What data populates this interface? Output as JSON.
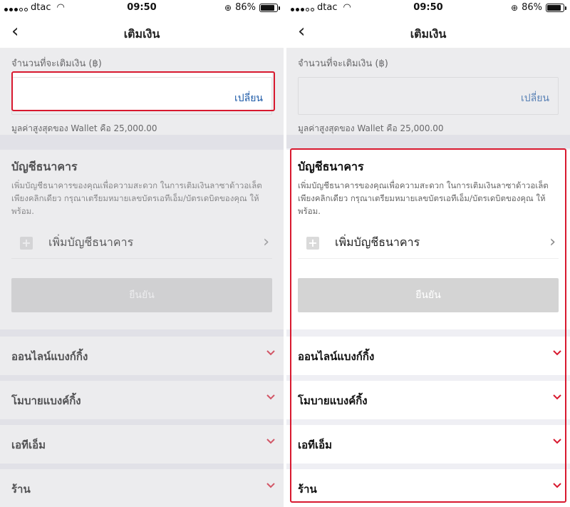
{
  "status_bar": {
    "carrier": "dtac",
    "time": "09:50",
    "battery": "86%"
  },
  "nav": {
    "title": "เติมเงิน"
  },
  "amount": {
    "label": "จำนวนที่จะเติมเงิน (฿)",
    "change_label": "เปลี่ยน",
    "max_note": "มูลค่าสูงสุดของ Wallet คือ 25,000.00"
  },
  "bank": {
    "title": "บัญชีธนาคาร",
    "description": "เพิ่มบัญชีธนาคารของคุณเพื่อความสะดวก ในการเติมเงินลาซาด้าวอเล็ต เพียงคลิกเดียว กรุณาเตรียมหมายเลขบัตรเอทีเอ็ม/บัตรเดบิตของคุณ ให้พร้อม.",
    "add_label": "เพิ่มบัญชีธนาคาร",
    "confirm_label": "ยืนยัน"
  },
  "methods": [
    {
      "label": "ออนไลน์แบงก์กิ้ง"
    },
    {
      "label": "โมบายแบงค์กิ้ง"
    },
    {
      "label": "เอทีเอ็ม"
    },
    {
      "label": "ร้าน"
    }
  ],
  "colors": {
    "accent": "#d8192f",
    "link": "#1e5ba8",
    "disabled_button": "#d4d4d4"
  },
  "icons": [
    "back-chevron-icon",
    "wifi-icon",
    "lock-rotation-icon",
    "battery-icon",
    "plus-icon",
    "chevron-right-icon",
    "chevron-down-icon"
  ]
}
